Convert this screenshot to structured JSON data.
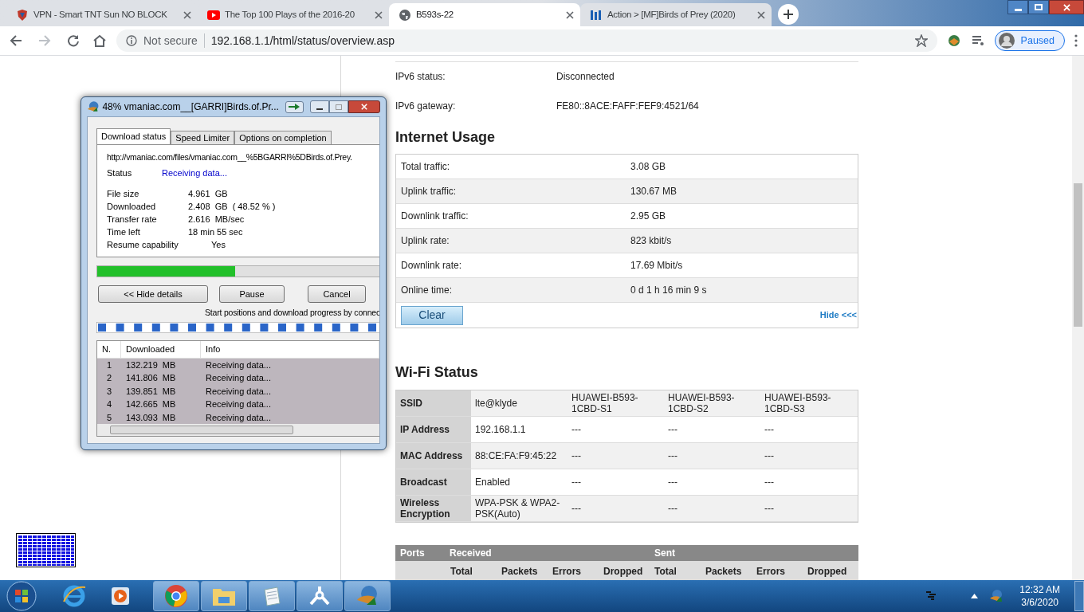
{
  "browser": {
    "tabs": [
      {
        "title": "VPN - Smart TNT Sun NO BLOCK",
        "selected": false
      },
      {
        "title": "The Top 100 Plays of the 2016-20",
        "selected": false
      },
      {
        "title": "B593s-22",
        "selected": true
      },
      {
        "title": "Action > [MF]Birds of Prey (2020)",
        "selected": false
      }
    ],
    "security": "Not secure",
    "url": "192.168.1.1/html/status/overview.asp",
    "profile": "Paused"
  },
  "ipv6": [
    {
      "label": "IPv6 status:",
      "value": "Disconnected"
    },
    {
      "label": "IPv6 gateway:",
      "value": "FE80::8ACE:FAFF:FEF9:4521/64"
    }
  ],
  "internet_usage": {
    "title": "Internet Usage",
    "rows": [
      {
        "label": "Total traffic:",
        "value": "3.08 GB"
      },
      {
        "label": "Uplink traffic:",
        "value": "130.67 MB"
      },
      {
        "label": "Downlink traffic:",
        "value": "2.95 GB"
      },
      {
        "label": "Uplink rate:",
        "value": "823 kbit/s"
      },
      {
        "label": "Downlink rate:",
        "value": "17.69 Mbit/s"
      },
      {
        "label": "Online time:",
        "value": "0 d 1 h 16 min 9 s"
      }
    ],
    "clear_button": "Clear",
    "hide_link": "Hide <<<"
  },
  "wifi_status": {
    "title": "Wi-Fi Status",
    "rows": [
      {
        "label": "SSID",
        "values": [
          "lte@klyde",
          "HUAWEI-B593-1CBD-S1",
          "HUAWEI-B593-1CBD-S2",
          "HUAWEI-B593-1CBD-S3"
        ]
      },
      {
        "label": "IP Address",
        "values": [
          "192.168.1.1",
          "---",
          "---",
          "---"
        ]
      },
      {
        "label": "MAC Address",
        "values": [
          "88:CE:FA:F9:45:22",
          "---",
          "---",
          "---"
        ]
      },
      {
        "label": "Broadcast",
        "values": [
          "Enabled",
          "---",
          "---",
          "---"
        ]
      },
      {
        "label": "Wireless Encryption",
        "values": [
          "WPA-PSK & WPA2-PSK(Auto)",
          "---",
          "---",
          "---"
        ]
      }
    ]
  },
  "ports_table": {
    "header": [
      "Ports",
      "Received",
      "Sent"
    ],
    "subheader": [
      "Total",
      "Packets",
      "Errors",
      "Dropped",
      "Total",
      "Packets",
      "Errors",
      "Dropped"
    ]
  },
  "download_dialog": {
    "title": "48% vmaniac.com__[GARRI]Birds.of.Pr...",
    "tabs": [
      {
        "label": "Download status",
        "selected": true
      },
      {
        "label": "Speed Limiter",
        "selected": false
      },
      {
        "label": "Options on completion",
        "selected": false
      }
    ],
    "url": "http://vmaniac.com/files/vmaniac.com__%5BGARRI%5DBirds.of.Prey.",
    "status_label": "Status",
    "status_value": "Receiving data...",
    "details": [
      {
        "label": "File size",
        "value": "4.961  GB"
      },
      {
        "label": "Downloaded",
        "value": "2.408  GB  ( 48.52 % )"
      },
      {
        "label": "Transfer rate",
        "value": "2.616  MB/sec"
      },
      {
        "label": "Time left",
        "value": "18 min 55 sec"
      },
      {
        "label": "Resume capability",
        "value": "Yes"
      }
    ],
    "progress": {
      "level": 0.49
    },
    "buttons": [
      "<< Hide details",
      "Pause",
      "Cancel"
    ],
    "connections_caption": "Start positions and download progress by connec",
    "columns": [
      "N.",
      "Downloaded",
      "Info"
    ],
    "rows": [
      {
        "n": "1",
        "downloaded": "132.219  MB",
        "info": "Receiving data...",
        "selected": true
      },
      {
        "n": "2",
        "downloaded": "141.806  MB",
        "info": "Receiving data...",
        "selected": true
      },
      {
        "n": "3",
        "downloaded": "139.851  MB",
        "info": "Receiving data...",
        "selected": true
      },
      {
        "n": "4",
        "downloaded": "142.665  MB",
        "info": "Receiving data...",
        "selected": true
      },
      {
        "n": "5",
        "downloaded": "143.093  MB",
        "info": "Receiving data...",
        "selected": true
      }
    ]
  },
  "taskbar": {
    "time": "12:32 AM",
    "date": "3/6/2020"
  }
}
